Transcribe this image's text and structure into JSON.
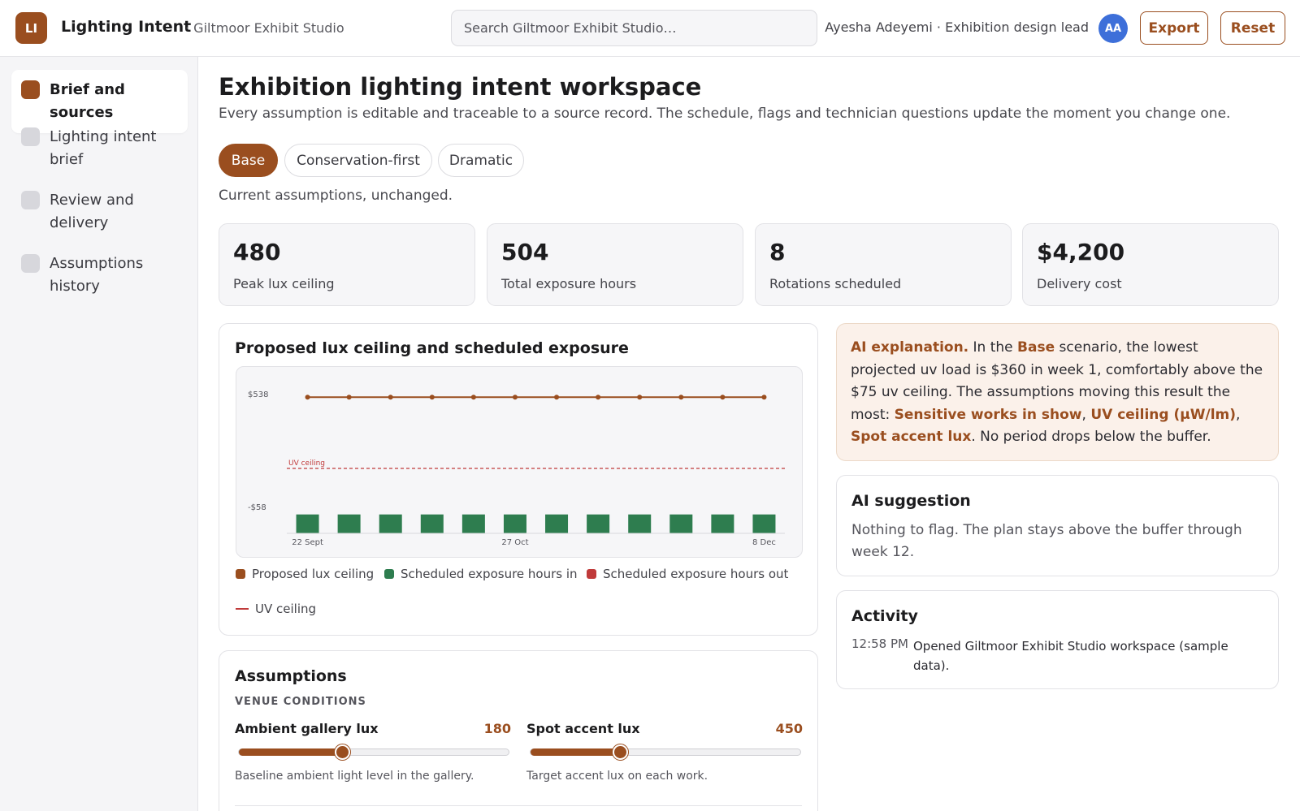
{
  "app": {
    "logo_initials": "LI",
    "title": "Lighting Intent",
    "workspace": "· Giltmoor Exhibit Studio",
    "search_placeholder": "Search Giltmoor Exhibit Studio…",
    "user": "Ayesha Adeyemi · Exhibition design lead",
    "avatar_initials": "AA",
    "export_label": "Export",
    "reset_label": "Reset"
  },
  "sidebar": {
    "items": [
      {
        "label": "Brief and sources",
        "active": true
      },
      {
        "label": "Lighting intent brief",
        "active": false
      },
      {
        "label": "Review and delivery",
        "active": false
      },
      {
        "label": "Assumptions history",
        "active": false
      }
    ]
  },
  "header": {
    "title": "Exhibition lighting intent workspace",
    "subtitle": "Every assumption is editable and traceable to a source record. The schedule, flags and technician questions update the moment you change one.",
    "scenarios": [
      "Base",
      "Conservation-first",
      "Dramatic"
    ],
    "active_scenario": "Base",
    "scenario_note": "Current assumptions, unchanged."
  },
  "kpis": [
    {
      "value": "480",
      "label": "Peak lux ceiling"
    },
    {
      "value": "504",
      "label": "Total exposure hours"
    },
    {
      "value": "8",
      "label": "Rotations scheduled"
    },
    {
      "value": "$4,200",
      "label": "Delivery cost"
    }
  ],
  "chart": {
    "title": "Proposed lux ceiling and scheduled exposure",
    "legend": {
      "proposed": "Proposed lux ceiling",
      "in": "Scheduled exposure hours in",
      "out": "Scheduled exposure hours out",
      "uv": "UV ceiling"
    },
    "colors": {
      "line": "#9a4e1f",
      "in": "#2e7d4f",
      "out": "#c03a3a",
      "uv": "#c03a3a"
    }
  },
  "chart_data": {
    "type": "bar",
    "categories": [
      "22 Sept",
      "",
      "",
      "",
      "",
      "27 Oct",
      "",
      "",
      "",
      "",
      "",
      "8 Dec"
    ],
    "tick_labels": [
      "22 Sept",
      "27 Oct",
      "8 Dec"
    ],
    "y_ticks": [
      "$538",
      "-$58"
    ],
    "ylim": [
      -200,
      538
    ],
    "series": [
      {
        "name": "Proposed lux ceiling",
        "type": "line",
        "values": [
          520,
          520,
          520,
          520,
          520,
          520,
          520,
          520,
          520,
          520,
          520,
          520
        ]
      },
      {
        "name": "Scheduled exposure hours in",
        "type": "bar",
        "values": [
          -100,
          -100,
          -100,
          -100,
          -100,
          -100,
          -100,
          -100,
          -100,
          -100,
          -100,
          -100
        ]
      },
      {
        "name": "Scheduled exposure hours out",
        "type": "bar",
        "values": []
      }
    ],
    "reference_lines": [
      {
        "name": "UV ceiling",
        "label": "UV ceiling",
        "value": 0
      }
    ],
    "grid": false,
    "legend_position": "bottom"
  },
  "assumptions": {
    "title": "Assumptions",
    "section": "VENUE CONDITIONS",
    "sliders": [
      {
        "label": "Ambient gallery lux",
        "value": "180",
        "fraction": 0.38,
        "help": "Baseline ambient light level in the gallery."
      },
      {
        "label": "Spot accent lux",
        "value": "450",
        "fraction": 0.33,
        "help": "Target accent lux on each work."
      }
    ]
  },
  "ai_explanation": {
    "lead": "AI explanation.",
    "t1": " In the ",
    "scenario": "Base",
    "t2": " scenario, the lowest projected uv load is $360 in week 1, comfortably above the $75 uv ceiling. The assumptions moving this result the most: ",
    "a1": "Sensitive works in show",
    "sep1": ", ",
    "a2": "UV ceiling (µW/lm)",
    "sep2": ", ",
    "a3": "Spot accent lux",
    "t3": ". No period drops below the buffer."
  },
  "ai_suggestion": {
    "title": "AI suggestion",
    "text": "Nothing to flag. The plan stays above the buffer through week 12."
  },
  "activity": {
    "title": "Activity",
    "items": [
      {
        "time": "12:58 PM",
        "text": "Opened Giltmoor Exhibit Studio workspace (sample data)."
      }
    ]
  }
}
